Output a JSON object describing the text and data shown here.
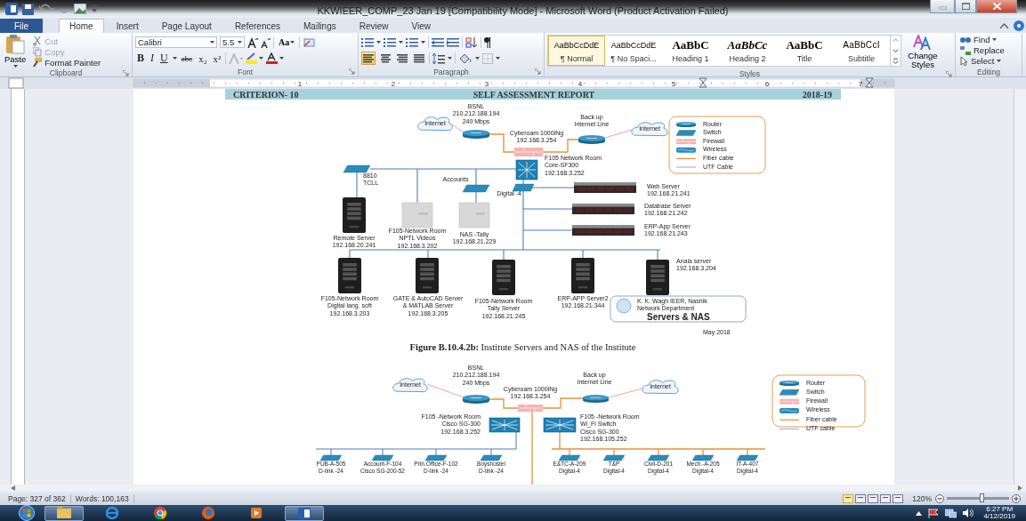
{
  "window": {
    "title": "KKWIEER_COMP_23 Jan 19 [Compatibility Mode]  -  Microsoft Word (Product Activation Failed)"
  },
  "tabs": [
    {
      "label": "File",
      "kind": "file",
      "selected": false
    },
    {
      "label": "Home",
      "kind": "tab",
      "selected": true
    },
    {
      "label": "Insert",
      "kind": "tab",
      "selected": false
    },
    {
      "label": "Page Layout",
      "kind": "tab",
      "selected": false
    },
    {
      "label": "References",
      "kind": "tab",
      "selected": false
    },
    {
      "label": "Mailings",
      "kind": "tab",
      "selected": false
    },
    {
      "label": "Review",
      "kind": "tab",
      "selected": false
    },
    {
      "label": "View",
      "kind": "tab",
      "selected": false
    }
  ],
  "clipboard": {
    "paste": "Paste",
    "items": [
      {
        "kind": "cut",
        "label": "Cut",
        "disabled": true
      },
      {
        "kind": "copy",
        "label": "Copy",
        "disabled": true
      },
      {
        "kind": "format_painter",
        "label": "Format Painter",
        "disabled": false
      }
    ],
    "group": "Clipboard"
  },
  "font": {
    "face": "Calibri",
    "size": "5.5",
    "change_case": "Aa",
    "format_buttons": [
      "B",
      "I",
      "U",
      "abc",
      "x₂",
      "x²"
    ],
    "group": "Font"
  },
  "paragraph": {
    "alignments": [
      {
        "selected": true
      },
      {
        "selected": false
      },
      {
        "selected": false
      },
      {
        "selected": false
      }
    ],
    "group": "Paragraph"
  },
  "styles": {
    "items": [
      {
        "kind": "normal",
        "preview": "AaBbCcDdE",
        "name": "¶ Normal",
        "selected": true
      },
      {
        "kind": "no_spacing",
        "preview": "AaBbCcDdE",
        "name": "¶ No Spaci...",
        "selected": false
      },
      {
        "kind": "heading1",
        "preview": "AaBbC",
        "name": "Heading 1",
        "selected": false
      },
      {
        "kind": "heading2",
        "preview": "AaBbCc",
        "name": "Heading 2",
        "selected": false
      },
      {
        "kind": "title",
        "preview": "AaBbC",
        "name": "Title",
        "selected": false
      },
      {
        "kind": "subtitle",
        "preview": "AaBbCcI",
        "name": "Subtitle",
        "selected": false
      }
    ],
    "change_styles": "Change Styles",
    "group": "Styles"
  },
  "editing": {
    "find": "Find",
    "replace": "Replace",
    "select": "Select",
    "group": "Editing"
  },
  "ruler": {
    "marks": [
      "1",
      "2",
      "3",
      "4",
      "5",
      "6",
      "7"
    ]
  },
  "document": {
    "header": [
      "CRITERION- 10",
      "SELF ASSESSMENT REPORT",
      "2018-19"
    ],
    "figure_1": {
      "nodes": [
        {
          "kind": "cloud",
          "label": [
            "Internet"
          ]
        },
        {
          "kind": "router",
          "label": [
            "BSNL",
            "210.212.188.194",
            "240 Mbps"
          ]
        },
        {
          "kind": "firewall",
          "label": [
            "Cyberoam 1000iNg",
            "192.168.3.254"
          ]
        },
        {
          "kind": "router",
          "label": [
            "Back up",
            "Internet  Line"
          ]
        },
        {
          "kind": "cloud",
          "label": [
            "Internet"
          ]
        },
        {
          "kind": "core_switch",
          "label": [
            "F105 Network Room",
            "Core-SF300",
            "192.168.3.252"
          ]
        },
        {
          "kind": "switch",
          "label": [
            "8810",
            "TCLL"
          ]
        },
        {
          "kind": "tower",
          "label": [
            "Remote Server",
            "192.168.20.241"
          ]
        },
        {
          "kind": "nas",
          "label": [
            "F105-Network Room",
            "NPTL Videos",
            "192.168.3.202"
          ]
        },
        {
          "kind": "switch",
          "label": [
            "Accounts"
          ]
        },
        {
          "kind": "nas",
          "label": [
            "NAS -Tally",
            "192.168.21.229"
          ]
        },
        {
          "kind": "switch",
          "label": [
            "Digital -4"
          ]
        },
        {
          "kind": "rack",
          "label": [
            "Web Server",
            "192.168.21.241"
          ]
        },
        {
          "kind": "rack",
          "label": [
            "Database Server",
            "192.168.21.242"
          ]
        },
        {
          "kind": "rack",
          "label": [
            "ERP-App Server",
            "192.168.21.243"
          ]
        },
        {
          "kind": "tower",
          "label": [
            "F105-Network Room",
            "Digital lang. soft",
            "192.168.3.203"
          ]
        },
        {
          "kind": "tower",
          "label": [
            "GATE & AutoCAD Server",
            "& MATLAB Server",
            "192.168.3.205"
          ]
        },
        {
          "kind": "tower",
          "label": [
            "F105-Network Room",
            "Tally Server",
            "192.168.21.245"
          ]
        },
        {
          "kind": "tower",
          "label": [
            "ERP-APP  Server2",
            "192.168.21.344"
          ]
        },
        {
          "kind": "tower",
          "label": [
            "Anaia server",
            "192.168.3.204"
          ]
        }
      ],
      "legend": [
        {
          "kind": "router",
          "label": "Router"
        },
        {
          "kind": "switch",
          "label": "Switch"
        },
        {
          "kind": "firewall",
          "label": "Firewall"
        },
        {
          "kind": "wireless",
          "label": "Wireless"
        },
        {
          "kind": "fiber",
          "label": "Fiber cable"
        },
        {
          "kind": "utp",
          "label": "UTF Cable"
        }
      ],
      "org": "K. K. Wagh IEER, Nashik",
      "department": "Network  Department",
      "title": "Servers & NAS",
      "date": "May 2018"
    },
    "caption": "**Figure B.10.4.2b:** Institute Servers and NAS of the Institute",
    "figure_2": {
      "nodes": [
        {
          "kind": "cloud",
          "label": [
            "Internet"
          ]
        },
        {
          "kind": "router",
          "label": [
            "BSNL",
            "210.212.188.194",
            "240  Mbps"
          ]
        },
        {
          "kind": "firewall",
          "label": [
            "Cyberoam 1000iNg",
            "192.168.3.254"
          ]
        },
        {
          "kind": "router",
          "label": [
            "Back  up",
            "Internet  Line"
          ]
        },
        {
          "kind": "cloud",
          "label": [
            "Internet"
          ]
        },
        {
          "kind": "core_switch",
          "label": [
            "F105 -Network Room",
            "Cisco SG-300",
            "192.168.3.252"
          ]
        },
        {
          "kind": "core_switch",
          "label": [
            "F105 -Network Room",
            "Wi_Fi Switch",
            "Cisco SG-300",
            "192.168.105.252"
          ]
        },
        {
          "kind": "switch",
          "label": [
            "PUB-A-505",
            "D-link -24"
          ]
        },
        {
          "kind": "switch",
          "label": [
            "Account-F-104",
            "Cisco SG-200-52"
          ]
        },
        {
          "kind": "switch",
          "label": [
            "Prin.Office-F-102",
            "D-link -24"
          ]
        },
        {
          "kind": "switch",
          "label": [
            "Boyshostel",
            "D-link -24"
          ]
        },
        {
          "kind": "switch",
          "label": [
            "E&TC-A-209",
            "Digital-4"
          ]
        },
        {
          "kind": "switch",
          "label": [
            "T&P",
            "Digital-4"
          ]
        },
        {
          "kind": "switch",
          "label": [
            "Civil-D-201",
            "Digital-4"
          ]
        },
        {
          "kind": "switch",
          "label": [
            "Mech.-A-205",
            "Digital-4"
          ]
        },
        {
          "kind": "switch",
          "label": [
            "IT-A-407",
            "Digital-4"
          ]
        }
      ],
      "legend": [
        {
          "kind": "router",
          "label": "Router"
        },
        {
          "kind": "switch",
          "label": "Switch"
        },
        {
          "kind": "firewall",
          "label": "Firewall"
        },
        {
          "kind": "wireless",
          "label": "Wireless"
        },
        {
          "kind": "fiber",
          "label": "Fiber cable"
        },
        {
          "kind": "utp",
          "label": "UTF cable"
        }
      ]
    }
  },
  "status_bar": {
    "page": "Page: 327 of 362",
    "words": "Words: 100,163",
    "zoom": "120%",
    "zoom_slider": {
      "level": 0.55
    }
  },
  "taskbar": {
    "time": "6:27 PM",
    "date": "4/12/2019"
  }
}
